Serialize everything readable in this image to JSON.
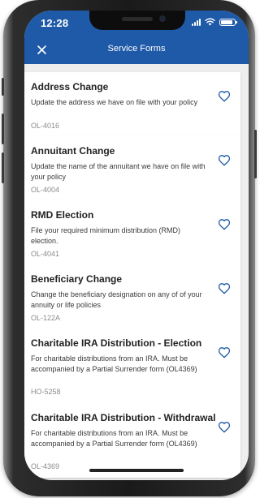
{
  "status_bar": {
    "time": "12:28",
    "battery_level": 0.85
  },
  "app_bar": {
    "title": "Service Forms",
    "close_icon": "close-icon"
  },
  "forms": [
    {
      "title": "Address Change",
      "description": "Update the address we have on file with your policy",
      "code": "OL-4016",
      "icon": "heart-outline-icon"
    },
    {
      "title": "Annuitant Change",
      "description": "Update the name of the annuitant we have on file with your policy",
      "code": "OL-4004",
      "icon": "heart-outline-icon"
    },
    {
      "title": "RMD Election",
      "description": "File your required minimum distribution (RMD) election.",
      "code": "OL-4041",
      "icon": "heart-outline-icon"
    },
    {
      "title": "Beneficiary Change",
      "description": "Change the beneficiary designation on any of of your annuity or life policies",
      "code": "OL-122A",
      "icon": "heart-outline-icon"
    },
    {
      "title": "Charitable IRA Distribution - Election",
      "description": "For charitable distributions from an IRA. Must be accompanied by a Partial Surrender form (OL4369)",
      "code": "HO-5258",
      "icon": "heart-outline-icon"
    },
    {
      "title": "Charitable IRA Distribution - Withdrawal",
      "description": "For charitable distributions from an IRA. Must be accompanied by a Partial Surrender form (OL4369)",
      "code": "OL-4369",
      "icon": "heart-outline-icon"
    }
  ],
  "colors": {
    "primary": "#1f5aa8",
    "background": "#eeeeee",
    "card": "#ffffff",
    "heart": "#1f5aa8"
  }
}
